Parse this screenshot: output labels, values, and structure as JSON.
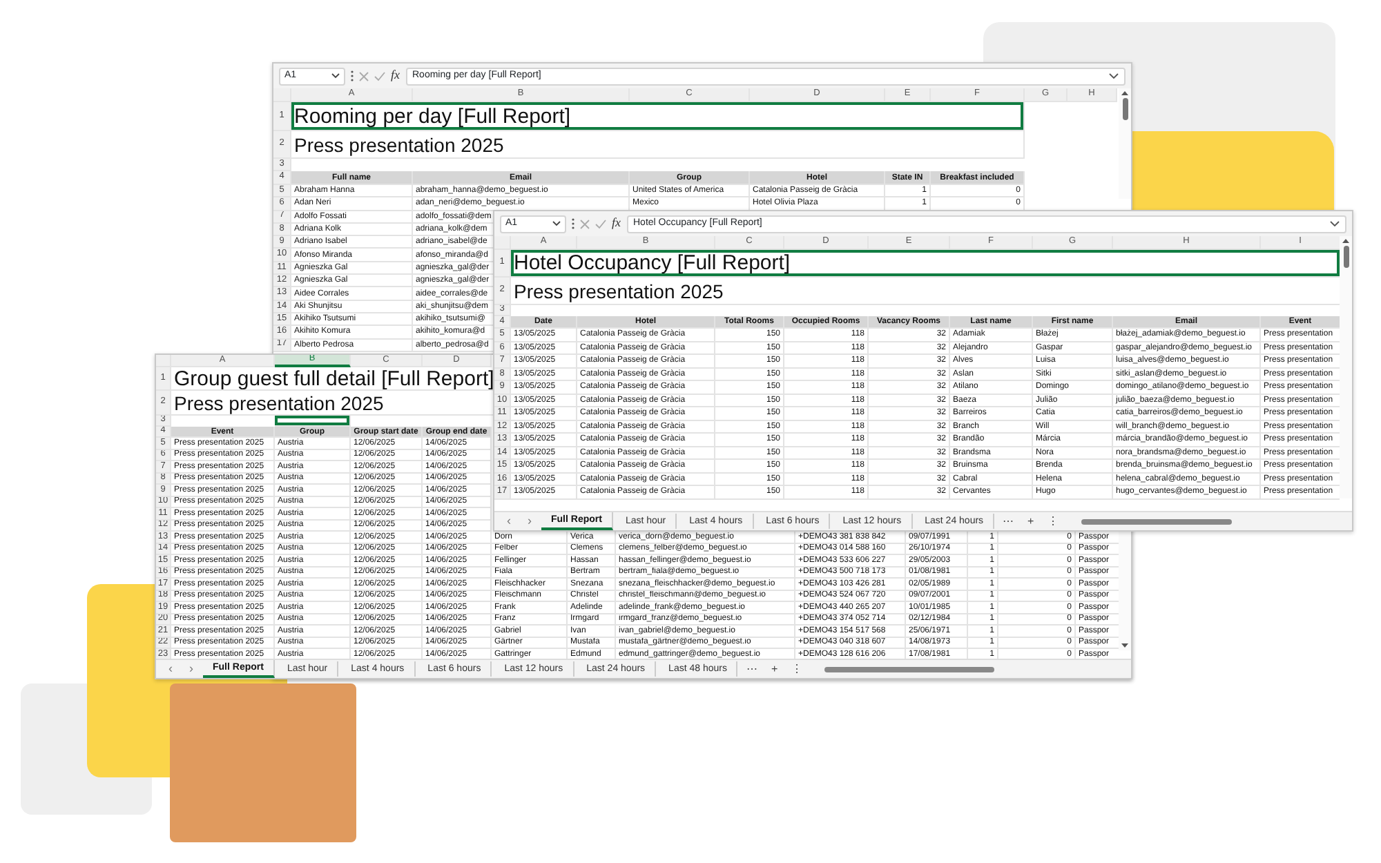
{
  "windows": [
    {
      "name_box": "A1",
      "function_label": "fx",
      "formula": "Rooming per day [Full Report]",
      "columns": [
        {
          "letter": "A",
          "selected": false
        },
        {
          "letter": "B",
          "selected": false
        },
        {
          "letter": "C",
          "selected": false
        },
        {
          "letter": "D",
          "selected": false
        },
        {
          "letter": "E",
          "selected": false
        },
        {
          "letter": "F",
          "selected": false
        },
        {
          "letter": "G",
          "selected": false
        },
        {
          "letter": "H",
          "selected": false
        }
      ],
      "rows": [
        {
          "number": "1",
          "kind": "title",
          "text": "Rooming per day [Full Report]",
          "selected": true
        },
        {
          "number": "2",
          "kind": "subtitle",
          "text": "Press presentation 2025",
          "selected": false
        },
        {
          "number": "3",
          "kind": "blank",
          "selected": false
        },
        {
          "number": "4",
          "kind": "header",
          "cells": [
            "Full name",
            "Email",
            "Group",
            "Hotel",
            "State IN",
            "Breakfast included"
          ]
        },
        {
          "number": "5",
          "kind": "data",
          "cells": [
            "Abraham Hanna",
            "abraham_hanna@demo_beguest.io",
            "United States of America",
            "Catalonia Passeig de Gràcia",
            "1",
            "0"
          ]
        },
        {
          "number": "6",
          "kind": "data",
          "cells": [
            "Adan Neri",
            "adan_neri@demo_beguest.io",
            "Mexico",
            "Hotel Olivia Plaza",
            "1",
            "0"
          ]
        },
        {
          "number": "7",
          "kind": "data",
          "cells": [
            "Adolfo Fossati",
            "adolfo_fossati@dem"
          ]
        },
        {
          "number": "8",
          "kind": "data",
          "cells": [
            "Adriana Kolk",
            "adriana_kolk@dem"
          ]
        },
        {
          "number": "9",
          "kind": "data",
          "cells": [
            "Adriano Isabel",
            "adriano_isabel@de"
          ]
        },
        {
          "number": "10",
          "kind": "data",
          "cells": [
            "Afonso Miranda",
            "afonso_miranda@d"
          ]
        },
        {
          "number": "11",
          "kind": "data",
          "cells": [
            "Agnieszka Gal",
            "agnieszka_gal@der"
          ]
        },
        {
          "number": "12",
          "kind": "data",
          "cells": [
            "Agnieszka Gal",
            "agnieszka_gal@der"
          ]
        },
        {
          "number": "13",
          "kind": "data",
          "cells": [
            "Aidee Corrales",
            "aidee_corrales@de"
          ]
        },
        {
          "number": "14",
          "kind": "data",
          "cells": [
            "Aki Shunjitsu",
            "aki_shunjitsu@dem"
          ]
        },
        {
          "number": "15",
          "kind": "data",
          "cells": [
            "Akihiko Tsutsumi",
            "akihiko_tsutsumi@"
          ]
        },
        {
          "number": "16",
          "kind": "data",
          "cells": [
            "Akihito Komura",
            "akihito_komura@d"
          ]
        },
        {
          "number": "17",
          "kind": "data",
          "cells": [
            "Alberto Pedrosa",
            "alberto_pedrosa@d"
          ]
        }
      ]
    },
    {
      "columns": [
        {
          "letter": "A",
          "selected": false
        },
        {
          "letter": "B",
          "selected": true
        },
        {
          "letter": "C",
          "selected": false
        },
        {
          "letter": "D",
          "selected": false
        }
      ],
      "rows": [
        {
          "number": "1",
          "kind": "title",
          "text": "Group guest full detail [Full Report]",
          "selected": false
        },
        {
          "number": "2",
          "kind": "subtitle",
          "text": "Press presentation 2025",
          "selected": false
        },
        {
          "number": "3",
          "kind": "blank",
          "selected": true
        },
        {
          "number": "4",
          "kind": "header",
          "cells": [
            "Event",
            "Group",
            "Group start date",
            "Group end date"
          ]
        },
        {
          "number": "5",
          "kind": "data",
          "cells": [
            "Press presentation 2025",
            "Austria",
            "12/06/2025",
            "14/06/2025"
          ]
        },
        {
          "number": "6",
          "kind": "data",
          "cells": [
            "Press presentation 2025",
            "Austria",
            "12/06/2025",
            "14/06/2025"
          ]
        },
        {
          "number": "7",
          "kind": "data",
          "cells": [
            "Press presentation 2025",
            "Austria",
            "12/06/2025",
            "14/06/2025"
          ]
        },
        {
          "number": "8",
          "kind": "data",
          "cells": [
            "Press presentation 2025",
            "Austria",
            "12/06/2025",
            "14/06/2025"
          ]
        },
        {
          "number": "9",
          "kind": "data",
          "cells": [
            "Press presentation 2025",
            "Austria",
            "12/06/2025",
            "14/06/2025"
          ]
        },
        {
          "number": "10",
          "kind": "data",
          "cells": [
            "Press presentation 2025",
            "Austria",
            "12/06/2025",
            "14/06/2025"
          ]
        },
        {
          "number": "11",
          "kind": "data",
          "cells": [
            "Press presentation 2025",
            "Austria",
            "12/06/2025",
            "14/06/2025"
          ]
        },
        {
          "number": "12",
          "kind": "data",
          "cells": [
            "Press presentation 2025",
            "Austria",
            "12/06/2025",
            "14/06/2025"
          ]
        },
        {
          "number": "13",
          "kind": "data",
          "cells": [
            "Press presentation 2025",
            "Austria",
            "12/06/2025",
            "14/06/2025",
            "Dorn",
            "Verica",
            "verica_dorn@demo_beguest.io",
            "+DEMO43 381 838 842",
            "09/07/1991",
            "1",
            "0",
            "Passpor"
          ]
        },
        {
          "number": "14",
          "kind": "data",
          "cells": [
            "Press presentation 2025",
            "Austria",
            "12/06/2025",
            "14/06/2025",
            "Felber",
            "Clemens",
            "clemens_felber@demo_beguest.io",
            "+DEMO43 014 588 160",
            "26/10/1974",
            "1",
            "0",
            "Passpor"
          ]
        },
        {
          "number": "15",
          "kind": "data",
          "cells": [
            "Press presentation 2025",
            "Austria",
            "12/06/2025",
            "14/06/2025",
            "Fellinger",
            "Hassan",
            "hassan_fellinger@demo_beguest.io",
            "+DEMO43 533 606 227",
            "29/05/2003",
            "1",
            "0",
            "Passpor"
          ]
        },
        {
          "number": "16",
          "kind": "data",
          "cells": [
            "Press presentation 2025",
            "Austria",
            "12/06/2025",
            "14/06/2025",
            "Fiala",
            "Bertram",
            "bertram_fiala@demo_beguest.io",
            "+DEMO43 500 718 173",
            "01/08/1981",
            "1",
            "0",
            "Passpor"
          ]
        },
        {
          "number": "17",
          "kind": "data",
          "cells": [
            "Press presentation 2025",
            "Austria",
            "12/06/2025",
            "14/06/2025",
            "Fleischhacker",
            "Snezana",
            "snezana_fleischhacker@demo_beguest.io",
            "+DEMO43 103 426 281",
            "02/05/1989",
            "1",
            "0",
            "Passpor"
          ]
        },
        {
          "number": "18",
          "kind": "data",
          "cells": [
            "Press presentation 2025",
            "Austria",
            "12/06/2025",
            "14/06/2025",
            "Fleischmann",
            "Christel",
            "christel_fleischmann@demo_beguest.io",
            "+DEMO43 524 067 720",
            "09/07/2001",
            "1",
            "0",
            "Passpor"
          ]
        },
        {
          "number": "19",
          "kind": "data",
          "cells": [
            "Press presentation 2025",
            "Austria",
            "12/06/2025",
            "14/06/2025",
            "Frank",
            "Adelinde",
            "adelinde_frank@demo_beguest.io",
            "+DEMO43 440 265 207",
            "10/01/1985",
            "1",
            "0",
            "Passpor"
          ]
        },
        {
          "number": "20",
          "kind": "data",
          "cells": [
            "Press presentation 2025",
            "Austria",
            "12/06/2025",
            "14/06/2025",
            "Franz",
            "Irmgard",
            "irmgard_franz@demo_beguest.io",
            "+DEMO43 374 052 714",
            "02/12/1984",
            "1",
            "0",
            "Passpor"
          ]
        },
        {
          "number": "21",
          "kind": "data",
          "cells": [
            "Press presentation 2025",
            "Austria",
            "12/06/2025",
            "14/06/2025",
            "Gabriel",
            "Ivan",
            "ivan_gabriel@demo_beguest.io",
            "+DEMO43 154 517 568",
            "25/06/1971",
            "1",
            "0",
            "Passpor"
          ]
        },
        {
          "number": "22",
          "kind": "data",
          "cells": [
            "Press presentation 2025",
            "Austria",
            "12/06/2025",
            "14/06/2025",
            "Gärtner",
            "Mustafa",
            "mustafa_gärtner@demo_beguest.io",
            "+DEMO43 040 318 607",
            "14/08/1973",
            "1",
            "0",
            "Passpor"
          ]
        },
        {
          "number": "23",
          "kind": "data",
          "cells": [
            "Press presentation 2025",
            "Austria",
            "12/06/2025",
            "14/06/2025",
            "Gattringer",
            "Edmund",
            "edmund_gattringer@demo_beguest.io",
            "+DEMO43 128 616 206",
            "17/08/1981",
            "1",
            "0",
            "Passpor"
          ]
        }
      ],
      "tab_nav": [
        "‹",
        "›"
      ],
      "tabs": [
        {
          "label": "Full Report",
          "selected": true
        },
        {
          "label": "Last hour",
          "selected": false
        },
        {
          "label": "Last 4 hours",
          "selected": false
        },
        {
          "label": "Last 6 hours",
          "selected": false
        },
        {
          "label": "Last 12 hours",
          "selected": false
        },
        {
          "label": "Last 24 hours",
          "selected": false
        },
        {
          "label": "Last 48 hours",
          "selected": false
        }
      ],
      "tab_tools": [
        "⋯",
        "+",
        "⋮"
      ]
    },
    {
      "name_box": "A1",
      "function_label": "fx",
      "formula": "Hotel Occupancy [Full Report]",
      "columns": [
        {
          "letter": "A",
          "selected": false
        },
        {
          "letter": "B",
          "selected": false
        },
        {
          "letter": "C",
          "selected": false
        },
        {
          "letter": "D",
          "selected": false
        },
        {
          "letter": "E",
          "selected": false
        },
        {
          "letter": "F",
          "selected": false
        },
        {
          "letter": "G",
          "selected": false
        },
        {
          "letter": "H",
          "selected": false
        },
        {
          "letter": "I",
          "selected": false
        }
      ],
      "rows": [
        {
          "number": "1",
          "kind": "title",
          "text": "Hotel Occupancy [Full Report]",
          "selected": true
        },
        {
          "number": "2",
          "kind": "subtitle",
          "text": "Press presentation 2025",
          "selected": false
        },
        {
          "number": "3",
          "kind": "blank",
          "selected": false
        },
        {
          "number": "4",
          "kind": "header",
          "cells": [
            "Date",
            "Hotel",
            "Total Rooms",
            "Occupied Rooms",
            "Vacancy Rooms",
            "Last name",
            "First name",
            "Email",
            "Event"
          ]
        },
        {
          "number": "5",
          "kind": "data",
          "cells": [
            "13/05/2025",
            "Catalonia Passeig de Gràcia",
            "150",
            "118",
            "32",
            "Adamiak",
            "Błażej",
            "błażej_adamiak@demo_beguest.io",
            "Press presentation"
          ]
        },
        {
          "number": "6",
          "kind": "data",
          "cells": [
            "13/05/2025",
            "Catalonia Passeig de Gràcia",
            "150",
            "118",
            "32",
            "Alejandro",
            "Gaspar",
            "gaspar_alejandro@demo_beguest.io",
            "Press presentation"
          ]
        },
        {
          "number": "7",
          "kind": "data",
          "cells": [
            "13/05/2025",
            "Catalonia Passeig de Gràcia",
            "150",
            "118",
            "32",
            "Alves",
            "Luisa",
            "luisa_alves@demo_beguest.io",
            "Press presentation"
          ]
        },
        {
          "number": "8",
          "kind": "data",
          "cells": [
            "13/05/2025",
            "Catalonia Passeig de Gràcia",
            "150",
            "118",
            "32",
            "Aslan",
            "Sitki",
            "sitki_aslan@demo_beguest.io",
            "Press presentation"
          ]
        },
        {
          "number": "9",
          "kind": "data",
          "cells": [
            "13/05/2025",
            "Catalonia Passeig de Gràcia",
            "150",
            "118",
            "32",
            "Atilano",
            "Domingo",
            "domingo_atilano@demo_beguest.io",
            "Press presentation"
          ]
        },
        {
          "number": "10",
          "kind": "data",
          "cells": [
            "13/05/2025",
            "Catalonia Passeig de Gràcia",
            "150",
            "118",
            "32",
            "Baeza",
            "Julião",
            "julião_baeza@demo_beguest.io",
            "Press presentation"
          ]
        },
        {
          "number": "11",
          "kind": "data",
          "cells": [
            "13/05/2025",
            "Catalonia Passeig de Gràcia",
            "150",
            "118",
            "32",
            "Barreiros",
            "Catia",
            "catia_barreiros@demo_beguest.io",
            "Press presentation"
          ]
        },
        {
          "number": "12",
          "kind": "data",
          "cells": [
            "13/05/2025",
            "Catalonia Passeig de Gràcia",
            "150",
            "118",
            "32",
            "Branch",
            "Will",
            "will_branch@demo_beguest.io",
            "Press presentation"
          ]
        },
        {
          "number": "13",
          "kind": "data",
          "cells": [
            "13/05/2025",
            "Catalonia Passeig de Gràcia",
            "150",
            "118",
            "32",
            "Brandão",
            "Márcia",
            "márcia_brandão@demo_beguest.io",
            "Press presentation"
          ]
        },
        {
          "number": "14",
          "kind": "data",
          "cells": [
            "13/05/2025",
            "Catalonia Passeig de Gràcia",
            "150",
            "118",
            "32",
            "Brandsma",
            "Nora",
            "nora_brandsma@demo_beguest.io",
            "Press presentation"
          ]
        },
        {
          "number": "15",
          "kind": "data",
          "cells": [
            "13/05/2025",
            "Catalonia Passeig de Gràcia",
            "150",
            "118",
            "32",
            "Bruinsma",
            "Brenda",
            "brenda_bruinsma@demo_beguest.io",
            "Press presentation"
          ]
        },
        {
          "number": "16",
          "kind": "data",
          "cells": [
            "13/05/2025",
            "Catalonia Passeig de Gràcia",
            "150",
            "118",
            "32",
            "Cabral",
            "Helena",
            "helena_cabral@demo_beguest.io",
            "Press presentation"
          ]
        },
        {
          "number": "17",
          "kind": "data",
          "cells": [
            "13/05/2025",
            "Catalonia Passeig de Gràcia",
            "150",
            "118",
            "32",
            "Cervantes",
            "Hugo",
            "hugo_cervantes@demo_beguest.io",
            "Press presentation"
          ]
        }
      ],
      "tab_nav": [
        "‹",
        "›"
      ],
      "tabs": [
        {
          "label": "Full Report",
          "selected": true
        },
        {
          "label": "Last hour",
          "selected": false
        },
        {
          "label": "Last 4 hours",
          "selected": false
        },
        {
          "label": "Last 6 hours",
          "selected": false
        },
        {
          "label": "Last 12 hours",
          "selected": false
        },
        {
          "label": "Last 24 hours",
          "selected": false
        }
      ],
      "tab_tools": [
        "⋯",
        "+",
        "⋮"
      ]
    }
  ]
}
